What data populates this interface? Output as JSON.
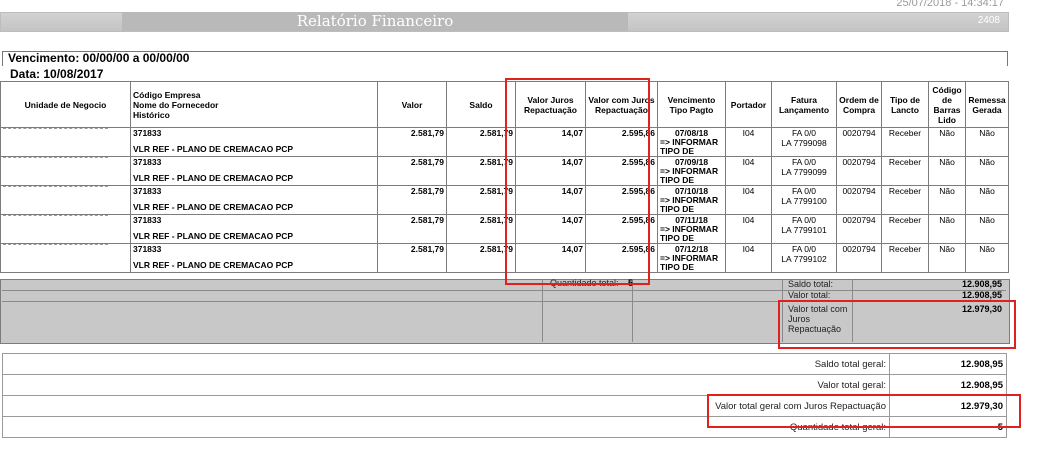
{
  "header": {
    "timestamp": "25/07/2018 - 14:34:17",
    "title": "Relatório Financeiro",
    "code": "2408"
  },
  "filters": {
    "vencimento": "Vencimento: 00/00/00 a 00/00/00",
    "data": "Data: 10/08/2017"
  },
  "columns": {
    "unidade": "Unidade de Negocio",
    "codigo": "Código Empresa",
    "fornecedor": "Nome do Fornecedor",
    "historico": "Histórico",
    "valor": "Valor",
    "saldo": "Saldo",
    "juros": "Valor Juros Repactuação",
    "valor_juros": "Valor com Juros Repactuação",
    "vencimento": "Vencimento Tipo Pagto",
    "portador": "Portador",
    "fatura": "Fatura Lançamento",
    "ordem": "Ordem de Compra",
    "tipo_lancto": "Tipo de Lancto",
    "barras": "Código de Barras Lido",
    "remessa": "Remessa Gerada"
  },
  "rows": [
    {
      "codigo": "371833",
      "historico": "VLR REF - PLANO DE CREMACAO PCP",
      "valor": "2.581,79",
      "saldo": "2.581,79",
      "juros": "14,07",
      "valor_juros": "2.595,86",
      "venc_date": "07/08/18",
      "venc_tipo": "=> INFORMAR TIPO DE",
      "portador": "I04",
      "fatura": "FA 0/0",
      "lancamento": "LA 7799098",
      "ordem": "0020794",
      "tipo": "Receber",
      "barras": "Não",
      "remessa": "Não"
    },
    {
      "codigo": "371833",
      "historico": "VLR REF - PLANO DE CREMACAO PCP",
      "valor": "2.581,79",
      "saldo": "2.581,79",
      "juros": "14,07",
      "valor_juros": "2.595,86",
      "venc_date": "07/09/18",
      "venc_tipo": "=> INFORMAR TIPO DE",
      "portador": "I04",
      "fatura": "FA 0/0",
      "lancamento": "LA 7799099",
      "ordem": "0020794",
      "tipo": "Receber",
      "barras": "Não",
      "remessa": "Não"
    },
    {
      "codigo": "371833",
      "historico": "VLR REF - PLANO DE CREMACAO PCP",
      "valor": "2.581,79",
      "saldo": "2.581,79",
      "juros": "14,07",
      "valor_juros": "2.595,86",
      "venc_date": "07/10/18",
      "venc_tipo": "=> INFORMAR TIPO DE",
      "portador": "I04",
      "fatura": "FA 0/0",
      "lancamento": "LA 7799100",
      "ordem": "0020794",
      "tipo": "Receber",
      "barras": "Não",
      "remessa": "Não"
    },
    {
      "codigo": "371833",
      "historico": "VLR REF - PLANO DE CREMACAO PCP",
      "valor": "2.581,79",
      "saldo": "2.581,79",
      "juros": "14,07",
      "valor_juros": "2.595,86",
      "venc_date": "07/11/18",
      "venc_tipo": "=> INFORMAR TIPO DE",
      "portador": "I04",
      "fatura": "FA 0/0",
      "lancamento": "LA 7799101",
      "ordem": "0020794",
      "tipo": "Receber",
      "barras": "Não",
      "remessa": "Não"
    },
    {
      "codigo": "371833",
      "historico": "VLR REF - PLANO DE CREMACAO PCP",
      "valor": "2.581,79",
      "saldo": "2.581,79",
      "juros": "14,07",
      "valor_juros": "2.595,86",
      "venc_date": "07/12/18",
      "venc_tipo": "=> INFORMAR TIPO DE",
      "portador": "I04",
      "fatura": "FA 0/0",
      "lancamento": "LA 7799102",
      "ordem": "0020794",
      "tipo": "Receber",
      "barras": "Não",
      "remessa": "Não"
    }
  ],
  "totals": {
    "quantidade_label": "Quantidade total:",
    "quantidade_value": "5",
    "saldo_label": "Saldo total:",
    "saldo_value": "12.908,95",
    "valor_label": "Valor total:",
    "valor_value": "12.908,95",
    "juros_label": "Valor total com Juros Repactuação",
    "juros_value": "12.979,30"
  },
  "grand_totals": [
    {
      "label": "Saldo total geral:",
      "value": "12.908,95"
    },
    {
      "label": "Valor total geral:",
      "value": "12.908,95"
    },
    {
      "label": "Valor total geral com Juros Repactuação",
      "value": "12.979,30"
    },
    {
      "label": "Quantidade total geral:",
      "value": "5"
    }
  ],
  "colors": {
    "highlight": "#e0221f",
    "title_bar": "#b9b9b9"
  }
}
